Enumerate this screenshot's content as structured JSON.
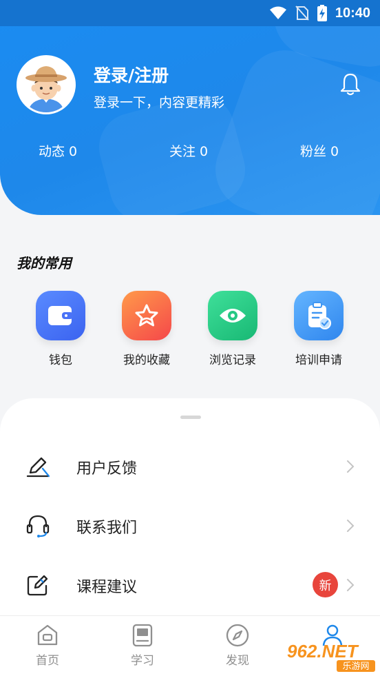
{
  "status_bar": {
    "time": "10:40"
  },
  "profile": {
    "title": "登录/注册",
    "subtitle": "登录一下，内容更精彩",
    "stats": [
      {
        "label": "动态 0"
      },
      {
        "label": "关注 0"
      },
      {
        "label": "粉丝 0"
      }
    ]
  },
  "favorites": {
    "title": "我的常用",
    "items": [
      {
        "label": "钱包",
        "icon": "wallet-icon"
      },
      {
        "label": "我的收藏",
        "icon": "star-icon"
      },
      {
        "label": "浏览记录",
        "icon": "eye-icon"
      },
      {
        "label": "培训申请",
        "icon": "clipboard-icon"
      }
    ]
  },
  "menu": [
    {
      "label": "用户反馈",
      "icon": "pencil-icon"
    },
    {
      "label": "联系我们",
      "icon": "headset-icon"
    },
    {
      "label": "课程建议",
      "icon": "edit-note-icon",
      "badge": "新"
    }
  ],
  "tabs": [
    {
      "label": "首页"
    },
    {
      "label": "学习"
    },
    {
      "label": "发现"
    }
  ],
  "watermark": {
    "brand": "962.NET",
    "site": "乐游网"
  },
  "colors": {
    "header_blue": "#1e88ea",
    "status_bar": "#1573cf",
    "badge_red": "#e8453c",
    "wallet": "#4a73f7",
    "star": "#f8694a",
    "eye": "#26c884",
    "apply": "#3f96f2"
  }
}
